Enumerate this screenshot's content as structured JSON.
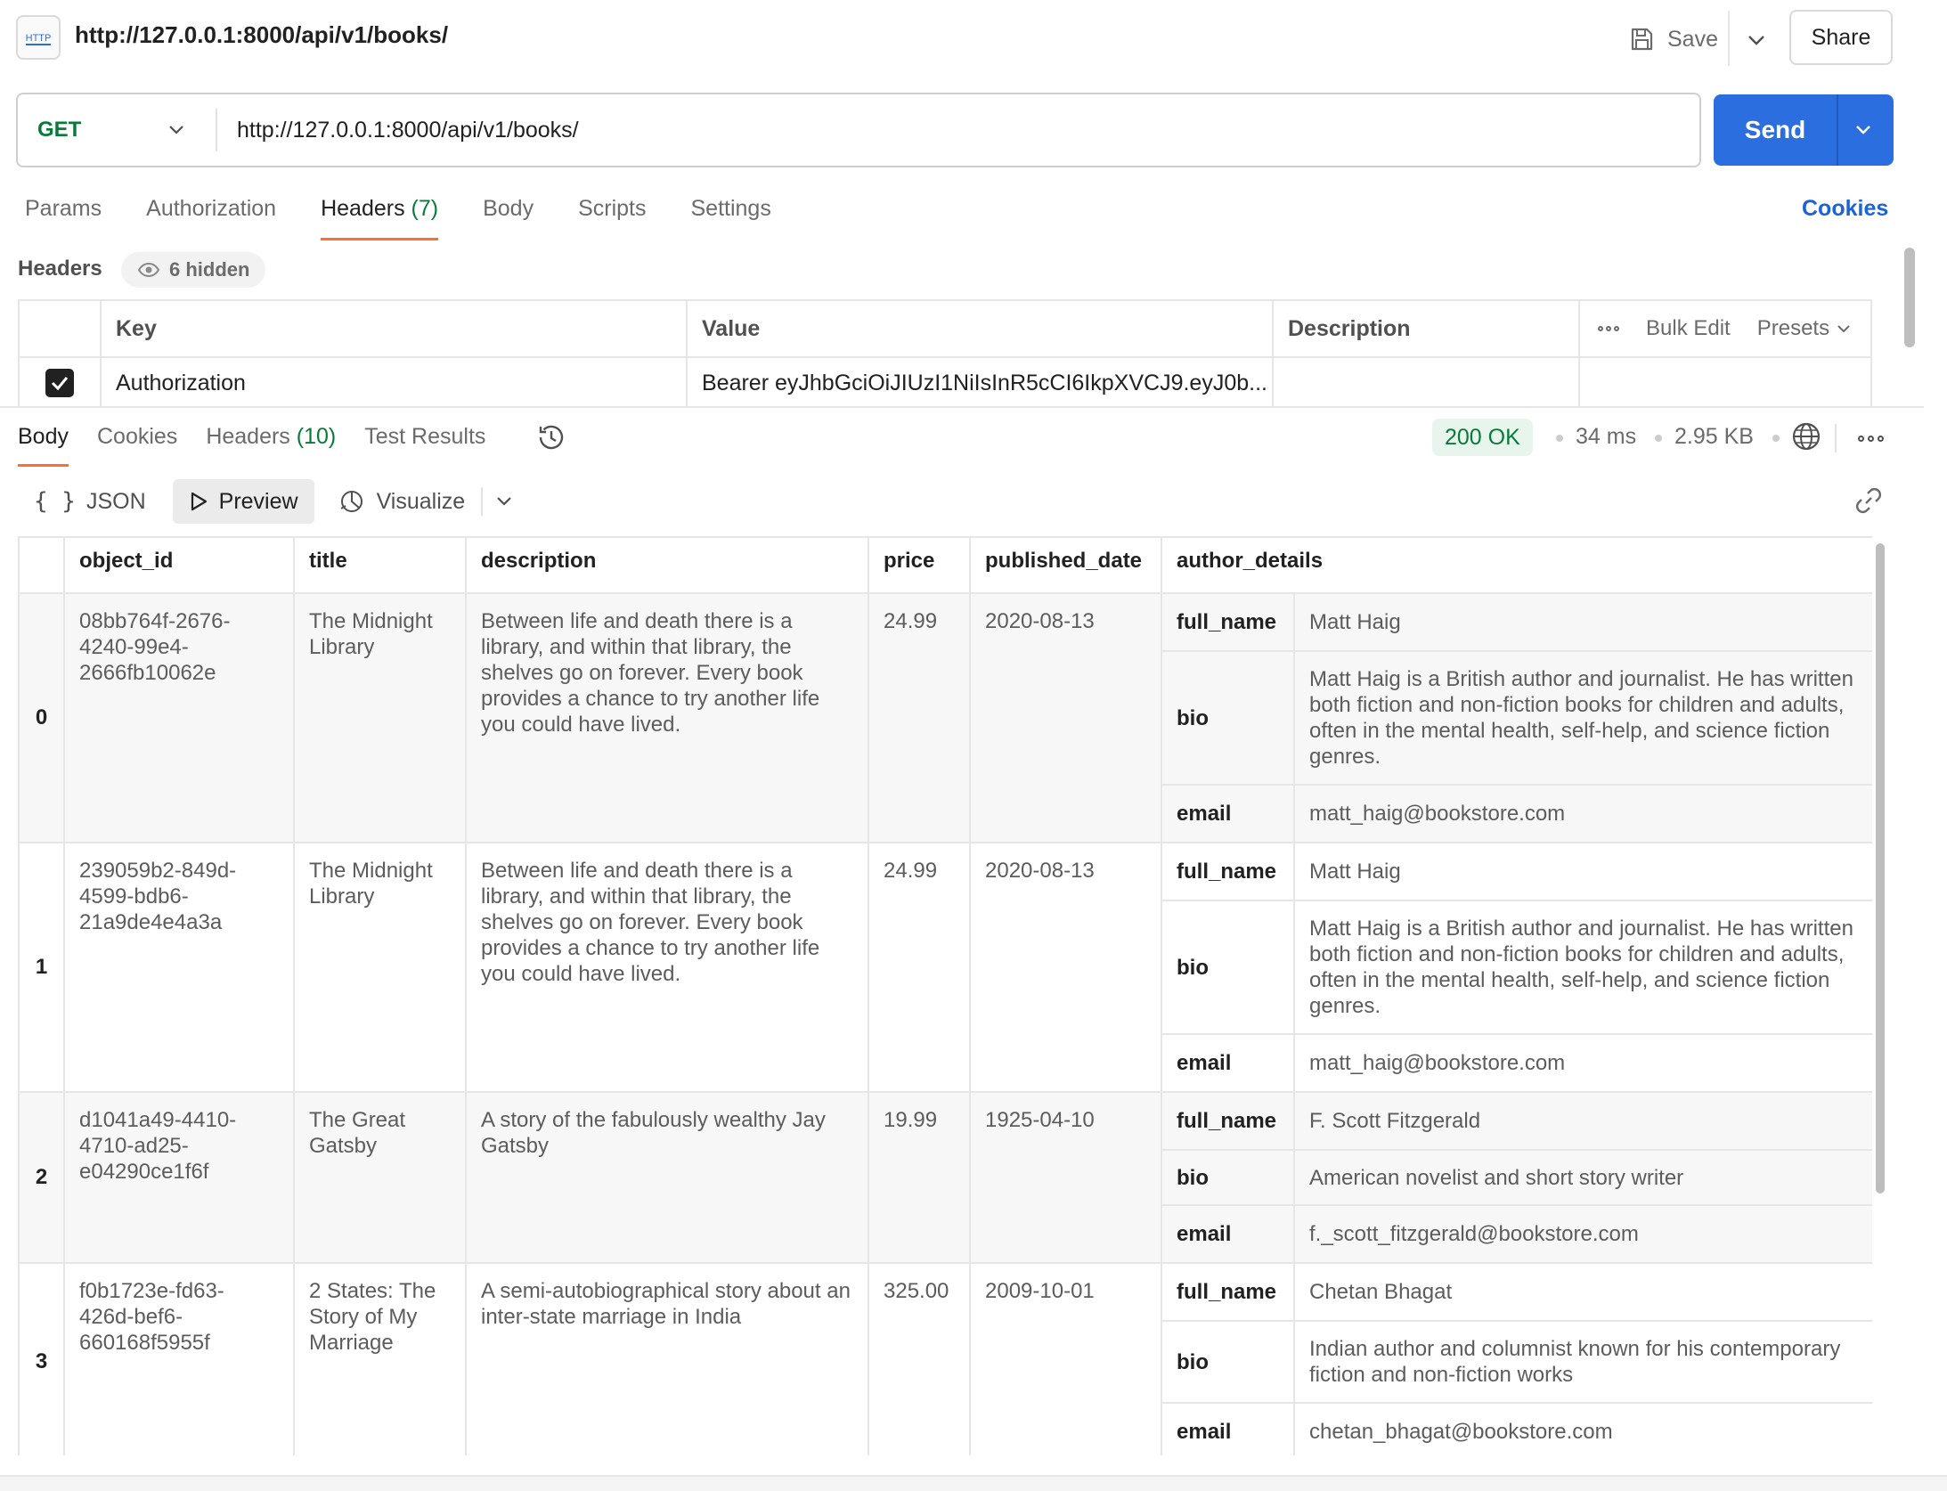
{
  "top": {
    "http_badge": "HTTP",
    "url": "http://127.0.0.1:8000/api/v1/books/",
    "save_label": "Save",
    "share_label": "Share"
  },
  "request": {
    "method": "GET",
    "url": "http://127.0.0.1:8000/api/v1/books/",
    "send_label": "Send"
  },
  "request_tabs": {
    "params": "Params",
    "authorization": "Authorization",
    "headers": "Headers",
    "headers_count": "(7)",
    "body": "Body",
    "scripts": "Scripts",
    "settings": "Settings",
    "cookies": "Cookies"
  },
  "headers_section": {
    "title": "Headers",
    "hidden_label": "6 hidden",
    "col_key": "Key",
    "col_value": "Value",
    "col_description": "Description",
    "bulk_edit": "Bulk Edit",
    "presets": "Presets",
    "row": {
      "key": "Authorization",
      "value": "Bearer eyJhbGciOiJIUzI1NiIsInR5cCI6IkpXVCJ9.eyJ0b...",
      "description": ""
    }
  },
  "response": {
    "tabs": {
      "body": "Body",
      "cookies": "Cookies",
      "headers": "Headers",
      "headers_count": "(10)",
      "test_results": "Test Results"
    },
    "status": "200 OK",
    "time": "34 ms",
    "size": "2.95 KB",
    "view": {
      "json": "JSON",
      "preview": "Preview",
      "visualize": "Visualize"
    },
    "columns": [
      "object_id",
      "title",
      "description",
      "price",
      "published_date",
      "author_details"
    ],
    "rows": [
      {
        "index": "0",
        "object_id": "08bb764f-2676-4240-99e4-2666fb10062e",
        "title": "The Midnight Library",
        "description": "Between life and death there is a library, and within that library, the shelves go on forever. Every book provides a chance to try another life you could have lived.",
        "price": "24.99",
        "published_date": "2020-08-13",
        "author": {
          "k_name": "full_name",
          "full_name": "Matt Haig",
          "k_bio": "bio",
          "bio": "Matt Haig is a British author and journalist. He has written both fiction and non-fiction books for children and adults, often in the mental health, self-help, and science fiction genres.",
          "k_email": "email",
          "email": "matt_haig@bookstore.com"
        }
      },
      {
        "index": "1",
        "object_id": "239059b2-849d-4599-bdb6-21a9de4e4a3a",
        "title": "The Midnight Library",
        "description": "Between life and death there is a library, and within that library, the shelves go on forever. Every book provides a chance to try another life you could have lived.",
        "price": "24.99",
        "published_date": "2020-08-13",
        "author": {
          "k_name": "full_name",
          "full_name": "Matt Haig",
          "k_bio": "bio",
          "bio": "Matt Haig is a British author and journalist. He has written both fiction and non-fiction books for children and adults, often in the mental health, self-help, and science fiction genres.",
          "k_email": "email",
          "email": "matt_haig@bookstore.com"
        }
      },
      {
        "index": "2",
        "object_id": "d1041a49-4410-4710-ad25-e04290ce1f6f",
        "title": "The Great Gatsby",
        "description": "A story of the fabulously wealthy Jay Gatsby",
        "price": "19.99",
        "published_date": "1925-04-10",
        "author": {
          "k_name": "full_name",
          "full_name": "F. Scott Fitzgerald",
          "k_bio": "bio",
          "bio": "American novelist and short story writer",
          "k_email": "email",
          "email": "f._scott_fitzgerald@bookstore.com"
        }
      },
      {
        "index": "3",
        "object_id": "f0b1723e-fd63-426d-bef6-660168f5955f",
        "title": "2 States: The Story of My Marriage",
        "description": "A semi-autobiographical story about an inter-state marriage in India",
        "price": "325.00",
        "published_date": "2009-10-01",
        "author": {
          "k_name": "full_name",
          "full_name": "Chetan Bhagat",
          "k_bio": "bio",
          "bio": "Indian author and columnist known for his contemporary fiction and non-fiction works",
          "k_email": "email",
          "email": "chetan_bhagat@bookstore.com"
        }
      }
    ]
  },
  "colors": {
    "accent": "#ff6c37",
    "send": "#2a6ee0",
    "method_get": "#0a7a3a",
    "link": "#1d63d8",
    "status_ok_bg": "#e8f5ec"
  }
}
